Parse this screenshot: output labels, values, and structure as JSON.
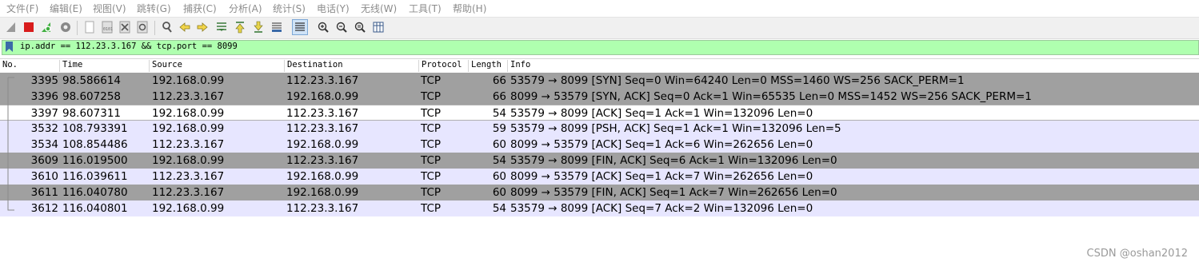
{
  "menu": [
    "文件(F)",
    "编辑(E)",
    "视图(V)",
    "跳转(G)",
    "捕获(C)",
    "分析(A)",
    "统计(S)",
    "电话(Y)",
    "无线(W)",
    "工具(T)",
    "帮助(H)"
  ],
  "toolbar_icons": [
    "shark-fin-start-icon",
    "stop-square-icon",
    "restart-shark-icon",
    "capture-options-gear-icon",
    "open-file-icon",
    "save-file-icon",
    "close-file-icon",
    "reload-icon",
    "find-packet-icon",
    "back-arrow-icon",
    "forward-arrow-icon",
    "go-to-packet-icon",
    "first-packet-icon",
    "last-packet-icon",
    "autoscroll-icon",
    "colorize-icon",
    "zoom-in-icon",
    "zoom-out-icon",
    "normal-size-icon",
    "resize-columns-icon"
  ],
  "filter": {
    "text": "ip.addr == 112.23.3.167 && tcp.port == 8099",
    "bg_color": "#afffaf"
  },
  "columns": [
    "No.",
    "Time",
    "Source",
    "Destination",
    "Protocol",
    "Length",
    "Info"
  ],
  "packets": [
    {
      "no": "3395",
      "time": "98.586614",
      "src": "192.168.0.99",
      "dst": "112.23.3.167",
      "proto": "TCP",
      "len": "66",
      "info": "53579 → 8099 [SYN] Seq=0 Win=64240 Len=0 MSS=1460 WS=256 SACK_PERM=1",
      "style": "dark"
    },
    {
      "no": "3396",
      "time": "98.607258",
      "src": "112.23.3.167",
      "dst": "192.168.0.99",
      "proto": "TCP",
      "len": "66",
      "info": "8099 → 53579 [SYN, ACK] Seq=0 Ack=1 Win=65535 Len=0 MSS=1452 WS=256 SACK_PERM=1",
      "style": "dark"
    },
    {
      "no": "3397",
      "time": "98.607311",
      "src": "192.168.0.99",
      "dst": "112.23.3.167",
      "proto": "TCP",
      "len": "54",
      "info": "53579 → 8099 [ACK] Seq=1 Ack=1 Win=132096 Len=0",
      "style": "selected"
    },
    {
      "no": "3532",
      "time": "108.793391",
      "src": "192.168.0.99",
      "dst": "112.23.3.167",
      "proto": "TCP",
      "len": "59",
      "info": "53579 → 8099 [PSH, ACK] Seq=1 Ack=1 Win=132096 Len=5",
      "style": "light"
    },
    {
      "no": "3534",
      "time": "108.854486",
      "src": "112.23.3.167",
      "dst": "192.168.0.99",
      "proto": "TCP",
      "len": "60",
      "info": "8099 → 53579 [ACK] Seq=1 Ack=6 Win=262656 Len=0",
      "style": "light"
    },
    {
      "no": "3609",
      "time": "116.019500",
      "src": "192.168.0.99",
      "dst": "112.23.3.167",
      "proto": "TCP",
      "len": "54",
      "info": "53579 → 8099 [FIN, ACK] Seq=6 Ack=1 Win=132096 Len=0",
      "style": "dark"
    },
    {
      "no": "3610",
      "time": "116.039611",
      "src": "112.23.3.167",
      "dst": "192.168.0.99",
      "proto": "TCP",
      "len": "60",
      "info": "8099 → 53579 [ACK] Seq=1 Ack=7 Win=262656 Len=0",
      "style": "light"
    },
    {
      "no": "3611",
      "time": "116.040780",
      "src": "112.23.3.167",
      "dst": "192.168.0.99",
      "proto": "TCP",
      "len": "60",
      "info": "8099 → 53579 [FIN, ACK] Seq=1 Ack=7 Win=262656 Len=0",
      "style": "dark"
    },
    {
      "no": "3612",
      "time": "116.040801",
      "src": "192.168.0.99",
      "dst": "112.23.3.167",
      "proto": "TCP",
      "len": "54",
      "info": "53579 → 8099 [ACK] Seq=7 Ack=2 Win=132096 Len=0",
      "style": "light"
    }
  ],
  "row_colors": {
    "dark": "#a0a0a0",
    "light": "#e7e6ff",
    "selected": "#ffffff"
  },
  "watermark": "CSDN @oshan2012"
}
